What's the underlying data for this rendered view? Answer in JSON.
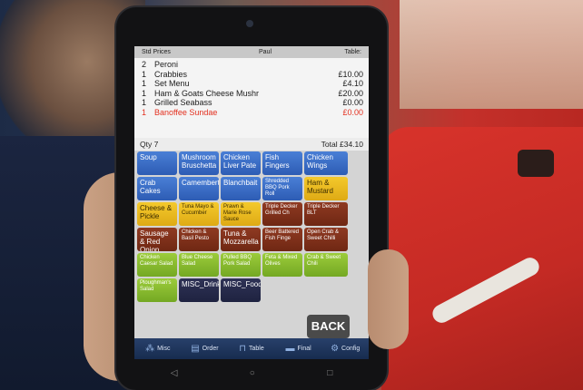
{
  "order": {
    "header": {
      "left": "Std Prices",
      "center": "Paul",
      "right": "Table:"
    },
    "items": [
      {
        "qty": "2",
        "name": "Peroni",
        "price": ""
      },
      {
        "qty": "1",
        "name": "Crabbies",
        "price": "£10.00"
      },
      {
        "qty": "1",
        "name": "Set Menu",
        "price": "£4.10"
      },
      {
        "qty": "1",
        "name": "Ham & Goats Cheese Mushr",
        "price": "£20.00"
      },
      {
        "qty": "1",
        "name": "Grilled Seabass",
        "price": "£0.00"
      },
      {
        "qty": "1",
        "name": "Banoffee Sundae",
        "price": "£0.00",
        "highlight": true
      }
    ],
    "qty_label": "Qty  7",
    "total_label": "Total  £34.10"
  },
  "menu_buttons": [
    {
      "label": "Soup",
      "color": "blue"
    },
    {
      "label": "Mushroom Bruschetta",
      "color": "blue"
    },
    {
      "label": "Chicken Liver Pate",
      "color": "blue"
    },
    {
      "label": "Fish Fingers",
      "color": "blue"
    },
    {
      "label": "Chicken Wings",
      "color": "blue"
    },
    {
      "label": "Crab Cakes",
      "color": "blue"
    },
    {
      "label": "Camembert",
      "color": "blue"
    },
    {
      "label": "Blanchbait",
      "color": "blue"
    },
    {
      "label": "Shredded BBQ Pork Roll",
      "color": "blue"
    },
    {
      "label": "Ham & Mustard",
      "color": "yellow"
    },
    {
      "label": "Cheese & Pickle",
      "color": "yellow"
    },
    {
      "label": "Tuna Mayo & Cucumber",
      "color": "yellow"
    },
    {
      "label": "Prawn & Marie Rose Sauce",
      "color": "yellow"
    },
    {
      "label": "Triple Decker Grilled Ch",
      "color": "brown"
    },
    {
      "label": "Triple Decker BLT",
      "color": "brown"
    },
    {
      "label": "Sausage & Red Onion",
      "color": "brown"
    },
    {
      "label": "Chicken & Basil Pesto",
      "color": "brown"
    },
    {
      "label": "Tuna & Mozzarella",
      "color": "brown"
    },
    {
      "label": "Beer Battered Fish Finge",
      "color": "brown"
    },
    {
      "label": "Open Crab & Sweet Chilli",
      "color": "brown"
    },
    {
      "label": "Chicken Caesar Salad",
      "color": "green"
    },
    {
      "label": "Blue Cheese Salad",
      "color": "green"
    },
    {
      "label": "Pulled BBQ Pork Salad",
      "color": "green"
    },
    {
      "label": "Feta & Mixed Olives",
      "color": "green"
    },
    {
      "label": "Crab & Sweet Chili",
      "color": "green"
    },
    {
      "label": "Ploughman's Salad",
      "color": "green"
    },
    {
      "label": "MISC_Drink",
      "color": "navy"
    },
    {
      "label": "MISC_Food",
      "color": "navy"
    }
  ],
  "back_label": "BACK",
  "toolbar": [
    {
      "label": "Misc",
      "icon": "misc-icon"
    },
    {
      "label": "Order",
      "icon": "order-icon"
    },
    {
      "label": "Table",
      "icon": "table-icon"
    },
    {
      "label": "Final",
      "icon": "final-icon"
    },
    {
      "label": "Config",
      "icon": "config-icon"
    }
  ],
  "android_nav": {
    "back": "◁",
    "home": "○",
    "recents": "□"
  }
}
